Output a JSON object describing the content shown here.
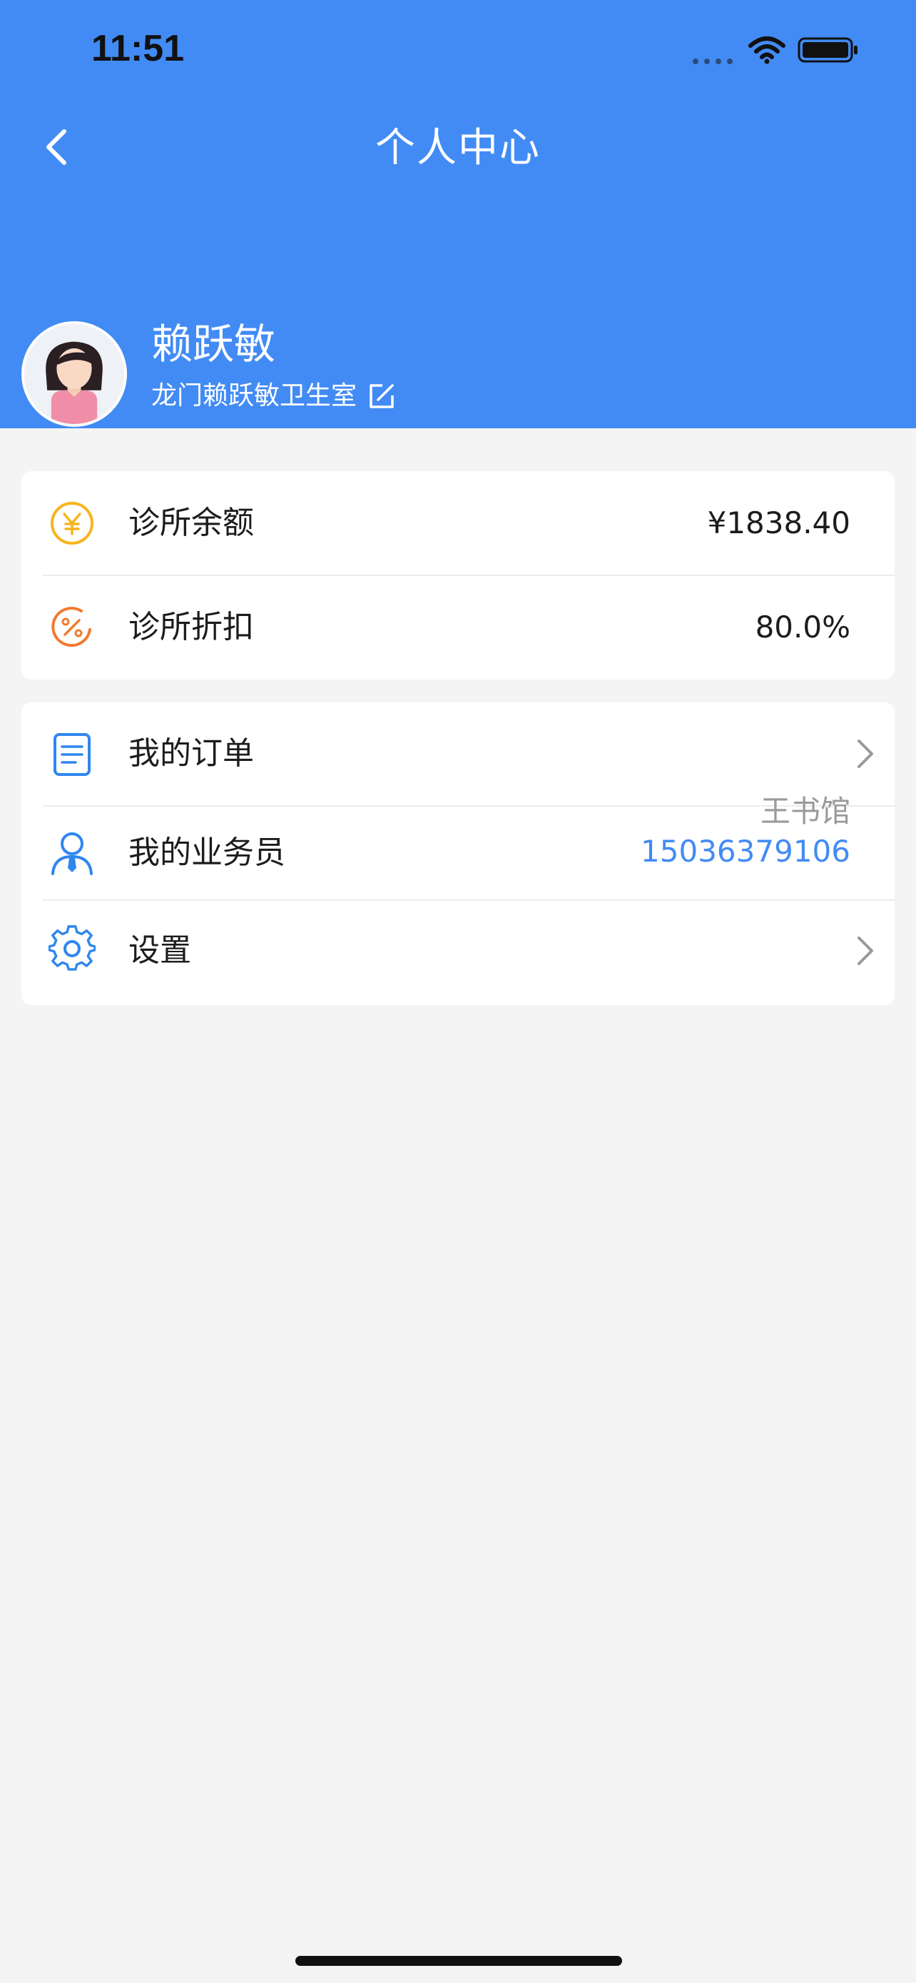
{
  "status_bar": {
    "time": "11:51"
  },
  "header": {
    "title": "个人中心"
  },
  "profile": {
    "name": "赖跃敏",
    "clinic": "龙门赖跃敏卫生室"
  },
  "account": {
    "balance_label": "诊所余额",
    "balance_value": "¥1838.40",
    "discount_label": "诊所折扣",
    "discount_value": "80.0%"
  },
  "menu": {
    "orders_label": "我的订单",
    "salesperson_label": "我的业务员",
    "salesperson_name": "王书馆",
    "salesperson_phone": "15036379106",
    "settings_label": "设置"
  },
  "colors": {
    "brand": "#428bf5",
    "balance_icon": "#f5b51e",
    "discount_icon": "#f3792e",
    "menu_icon": "#2f86ef"
  },
  "icons": {
    "back": "chevron-left-icon",
    "edit": "edit-icon",
    "balance": "yen-coin-icon",
    "discount": "percent-coin-icon",
    "orders": "document-icon",
    "salesperson": "person-tie-icon",
    "settings": "gear-icon"
  }
}
